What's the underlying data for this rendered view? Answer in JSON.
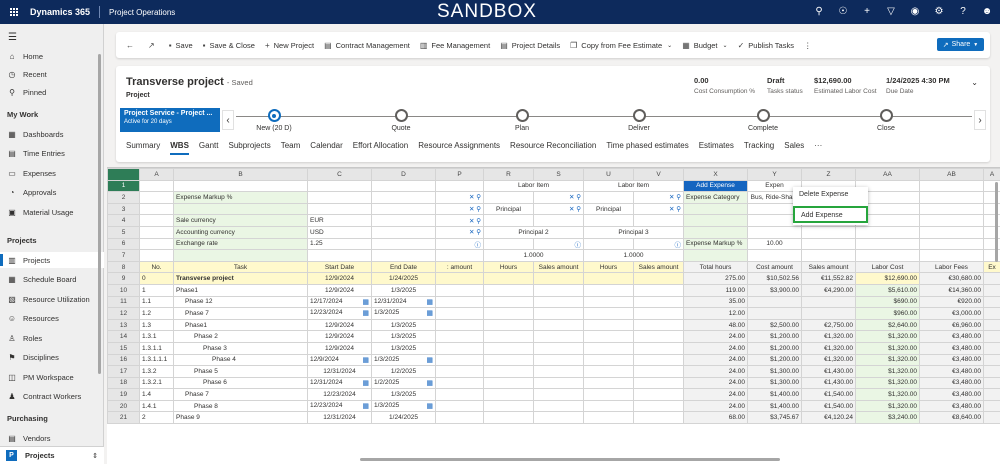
{
  "topbar": {
    "brand": "Dynamics 365",
    "app": "Project Operations",
    "env": "SANDBOX",
    "icons": [
      "search-icon",
      "lightbulb-icon",
      "plus-icon",
      "filter-icon",
      "bell-icon",
      "gear-icon",
      "help-icon",
      "person-icon"
    ]
  },
  "sidebar": {
    "top_items": [
      {
        "label": "Home",
        "icon": "home-icon"
      },
      {
        "label": "Recent",
        "icon": "clock-icon"
      },
      {
        "label": "Pinned",
        "icon": "pin-icon"
      }
    ],
    "groups": [
      {
        "title": "My Work",
        "items": [
          {
            "label": "Dashboards",
            "icon": "dashboard-icon"
          },
          {
            "label": "Time Entries",
            "icon": "calendar-icon"
          },
          {
            "label": "Expenses",
            "icon": "receipt-icon"
          },
          {
            "label": "Approvals",
            "icon": "approval-icon"
          },
          {
            "label": "Material Usage",
            "icon": "material-icon"
          }
        ]
      },
      {
        "title": "Projects",
        "items": [
          {
            "label": "Projects",
            "icon": "project-icon",
            "active": true
          },
          {
            "label": "Schedule Board",
            "icon": "board-icon"
          },
          {
            "label": "Resource Utilization",
            "icon": "chart-icon"
          },
          {
            "label": "Resources",
            "icon": "person-icon"
          },
          {
            "label": "Roles",
            "icon": "roles-icon"
          },
          {
            "label": "Disciplines",
            "icon": "discipline-icon"
          },
          {
            "label": "PM Workspace",
            "icon": "workspace-icon"
          },
          {
            "label": "Contract Workers",
            "icon": "contract-icon"
          }
        ]
      },
      {
        "title": "Purchasing",
        "items": [
          {
            "label": "Vendors",
            "icon": "vendor-icon"
          }
        ]
      }
    ],
    "area": {
      "badge": "P",
      "label": "Projects"
    }
  },
  "commands": [
    {
      "label": "Save",
      "icon": "save-icon"
    },
    {
      "label": "Save & Close",
      "icon": "save-close-icon"
    },
    {
      "label": "New Project",
      "icon": "plus-icon"
    },
    {
      "label": "Contract Management",
      "icon": "document-icon"
    },
    {
      "label": "Fee Management",
      "icon": "fee-icon"
    },
    {
      "label": "Project Details",
      "icon": "details-icon"
    },
    {
      "label": "Copy from Fee Estimate",
      "icon": "copy-icon",
      "dropdown": true
    },
    {
      "label": "Budget",
      "icon": "budget-icon",
      "dropdown": true
    },
    {
      "label": "Publish Tasks",
      "icon": "check-icon"
    }
  ],
  "share_label": "Share",
  "header": {
    "title": "Transverse project",
    "saved": "- Saved",
    "entity": "Project",
    "fields": [
      {
        "value": "0.00",
        "label": "Cost Consumption %"
      },
      {
        "value": "Draft",
        "label": "Tasks status"
      },
      {
        "value": "$12,690.00",
        "label": "Estimated Labor Cost"
      },
      {
        "value": "1/24/2025 4:30 PM",
        "label": "Due Date"
      }
    ]
  },
  "bpf": {
    "active_name": "Project Service - Project ...",
    "active_sub": "Active for 20 days",
    "stages": [
      "New  (20 D)",
      "Quote",
      "Plan",
      "Deliver",
      "Complete",
      "Close"
    ]
  },
  "tabs": [
    "Summary",
    "WBS",
    "Gantt",
    "Subprojects",
    "Team",
    "Calendar",
    "Effort Allocation",
    "Resource Assignments",
    "Resource Reconciliation",
    "Time phased estimates",
    "Estimates",
    "Tracking",
    "Sales",
    "···"
  ],
  "grid": {
    "columns": [
      "",
      "A",
      "B",
      "C",
      "D",
      "P",
      "R",
      "S",
      "U",
      "V",
      "X",
      "Y",
      "Z",
      "AA",
      "AB",
      "A"
    ],
    "row1": {
      "rh": "1",
      "labor1": "Labor Item",
      "labor2": "Labor Item",
      "add_expense": "Add Expense",
      "expense": "Expen"
    },
    "params": [
      {
        "rh": "2",
        "label": "Expense Markup %",
        "v": "",
        "x_label": "Expense Category",
        "y_value": "Bus, Ride-Share"
      },
      {
        "rh": "3",
        "label": "",
        "v": "",
        "r_val": "Principal",
        "u_val": "Principal"
      },
      {
        "rh": "4",
        "label": "Sale currency",
        "v": "EUR"
      },
      {
        "rh": "5",
        "label": "Accounting currency",
        "v": "USD",
        "r_val": "Principal 2",
        "u_val": "Principal 3"
      },
      {
        "rh": "6",
        "label": "Exchange rate",
        "v": "1.25",
        "x_label": "Expense Markup %",
        "y_value": "10.00"
      },
      {
        "rh": "7",
        "label": "",
        "v": "",
        "r_val": "1.0000",
        "u_val": "1.0000"
      }
    ],
    "header_row": {
      "rh": "8",
      "no": "No.",
      "task": "Task",
      "start": "Start Date",
      "end": "End Date",
      "p": ": amount",
      "r": "Hours",
      "s": "Sales amount",
      "u": "Hours",
      "v": "Sales amount",
      "x": "Total hours",
      "y": "Cost amount",
      "z": "Sales amount",
      "aa": "Labor Cost",
      "ab": "Labor Fees",
      "ac": "Ex"
    },
    "rows": [
      {
        "rh": "9",
        "no": "0",
        "task": "Transverse project",
        "indent": 0,
        "start": "12/9/2024",
        "end": "1/24/2025",
        "x": "275.00",
        "y": "$10,502.56",
        "z": "€11,552.82",
        "aa": "$12,690.00",
        "ab": "€30,680.00",
        "bold": true,
        "cal": false
      },
      {
        "rh": "10",
        "no": "1",
        "task": "Phase1",
        "indent": 0,
        "start": "12/9/2024",
        "end": "1/3/2025",
        "x": "119.00",
        "y": "$3,900.00",
        "z": "€4,290.00",
        "aa": "$5,610.00",
        "ab": "€14,360.00",
        "cal": false
      },
      {
        "rh": "11",
        "no": "1.1",
        "task": "Phase 12",
        "indent": 2,
        "start": "12/17/2024",
        "end": "12/31/2024",
        "x": "35.00",
        "y": "",
        "z": "",
        "aa": "$690.00",
        "ab": "€920.00",
        "cal": true
      },
      {
        "rh": "12",
        "no": "1.2",
        "task": "Phase 7",
        "indent": 2,
        "start": "12/23/2024",
        "end": "1/3/2025",
        "x": "12.00",
        "y": "",
        "z": "",
        "aa": "$960.00",
        "ab": "€3,000.00",
        "cal": true
      },
      {
        "rh": "13",
        "no": "1.3",
        "task": "Phase1",
        "indent": 2,
        "start": "12/9/2024",
        "end": "1/3/2025",
        "x": "48.00",
        "y": "$2,500.00",
        "z": "€2,750.00",
        "aa": "$2,640.00",
        "ab": "€6,960.00",
        "cal": false
      },
      {
        "rh": "14",
        "no": "1.3.1",
        "task": "Phase 2",
        "indent": 4,
        "start": "12/9/2024",
        "end": "1/3/2025",
        "x": "24.00",
        "y": "$1,200.00",
        "z": "€1,320.00",
        "aa": "$1,320.00",
        "ab": "€3,480.00",
        "cal": false
      },
      {
        "rh": "15",
        "no": "1.3.1.1",
        "task": "Phase 3",
        "indent": 6,
        "start": "12/9/2024",
        "end": "1/3/2025",
        "x": "24.00",
        "y": "$1,200.00",
        "z": "€1,320.00",
        "aa": "$1,320.00",
        "ab": "€3,480.00",
        "cal": false
      },
      {
        "rh": "16",
        "no": "1.3.1.1.1",
        "task": "Phase 4",
        "indent": 8,
        "start": "12/9/2024",
        "end": "1/3/2025",
        "x": "24.00",
        "y": "$1,200.00",
        "z": "€1,320.00",
        "aa": "$1,320.00",
        "ab": "€3,480.00",
        "cal": true
      },
      {
        "rh": "17",
        "no": "1.3.2",
        "task": "Phase 5",
        "indent": 4,
        "start": "12/31/2024",
        "end": "1/2/2025",
        "x": "24.00",
        "y": "$1,300.00",
        "z": "€1,430.00",
        "aa": "$1,320.00",
        "ab": "€3,480.00",
        "cal": false
      },
      {
        "rh": "18",
        "no": "1.3.2.1",
        "task": "Phase 6",
        "indent": 6,
        "start": "12/31/2024",
        "end": "1/2/2025",
        "x": "24.00",
        "y": "$1,300.00",
        "z": "€1,430.00",
        "aa": "$1,320.00",
        "ab": "€3,480.00",
        "cal": true
      },
      {
        "rh": "19",
        "no": "1.4",
        "task": "Phase 7",
        "indent": 2,
        "start": "12/23/2024",
        "end": "1/3/2025",
        "x": "24.00",
        "y": "$1,400.00",
        "z": "€1,540.00",
        "aa": "$1,320.00",
        "ab": "€3,480.00",
        "cal": false
      },
      {
        "rh": "20",
        "no": "1.4.1",
        "task": "Phase 8",
        "indent": 4,
        "start": "12/23/2024",
        "end": "1/3/2025",
        "x": "24.00",
        "y": "$1,400.00",
        "z": "€1,540.00",
        "aa": "$1,320.00",
        "ab": "€3,480.00",
        "cal": true
      },
      {
        "rh": "21",
        "no": "2",
        "task": "Phase 9",
        "indent": 0,
        "start": "12/31/2024",
        "end": "1/24/2025",
        "x": "68.00",
        "y": "$3,745.67",
        "z": "€4,120.24",
        "aa": "$3,240.00",
        "ab": "€8,640.00",
        "cal": false
      }
    ]
  },
  "context_menu": {
    "items": [
      "Delete Expense",
      "Add Expense"
    ],
    "highlighted": "Add Expense"
  },
  "colors": {
    "topbar": "#0d2a5c",
    "accent": "#0f6cbd",
    "selected_col": "#2e7d57",
    "green_cell": "#eaf6e4",
    "yellow_row": "#fff9cc",
    "highlight_border": "#26a53c"
  }
}
